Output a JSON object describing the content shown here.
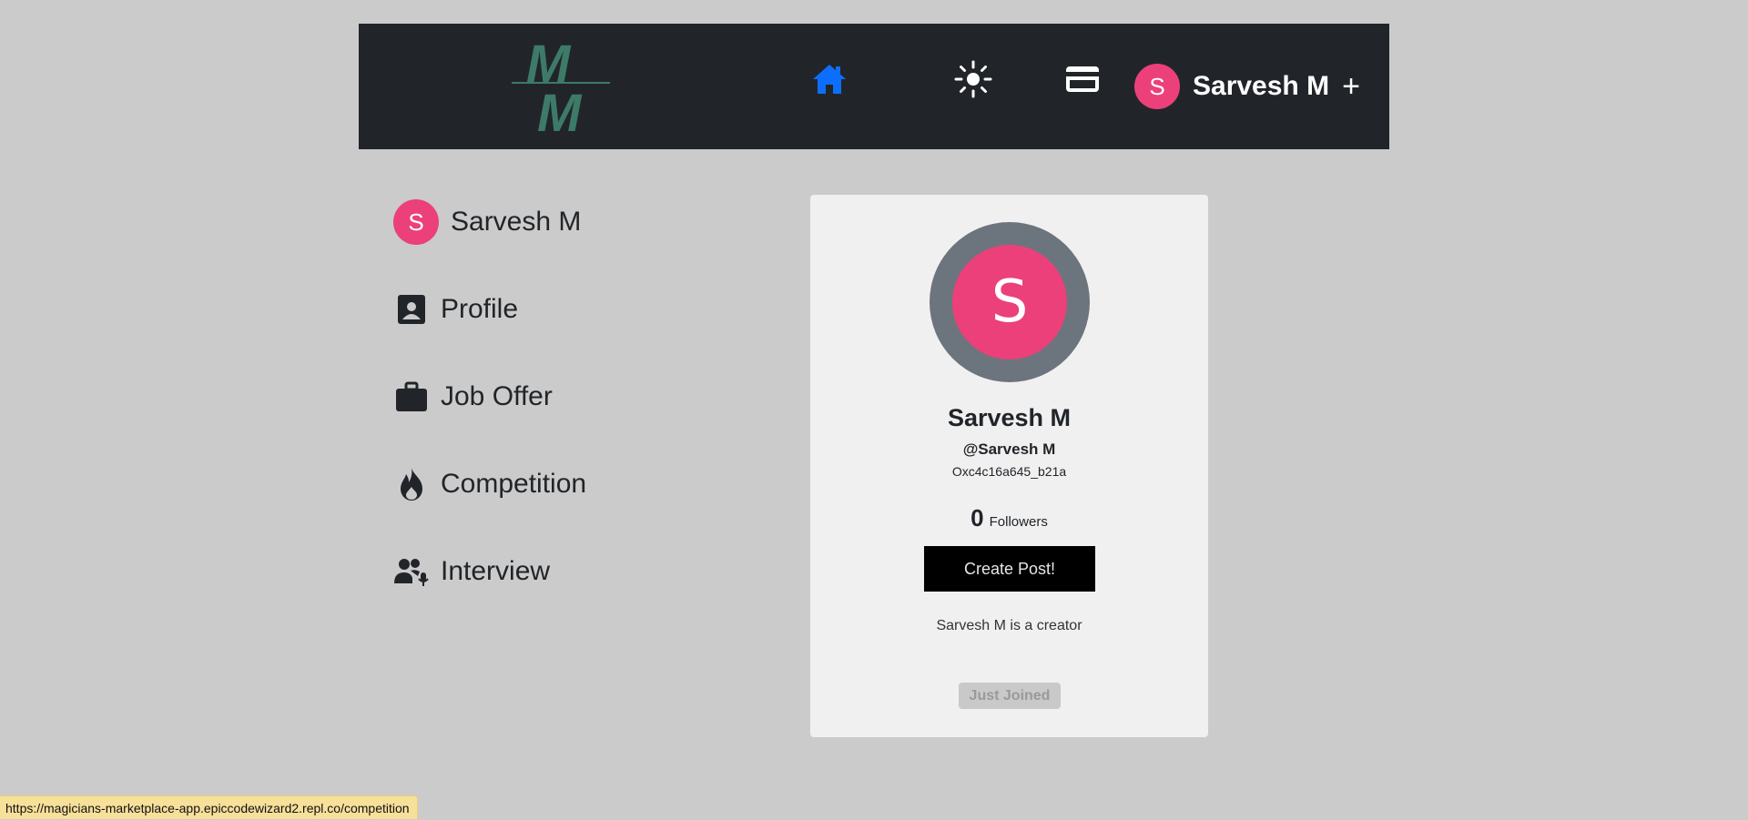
{
  "navbar": {
    "logo_letters": "MM",
    "user": {
      "avatar_initial": "S",
      "name": "Sarvesh M",
      "add_symbol": "+"
    },
    "icons": {
      "home": "home-icon",
      "theme": "sun-icon",
      "wallet": "credit-card-icon"
    },
    "colors": {
      "background": "#212529",
      "home_active": "#0d6efd",
      "logo": "#3d7a68"
    }
  },
  "sidebar": {
    "user": {
      "avatar_initial": "S",
      "name": "Sarvesh M"
    },
    "items": [
      {
        "label": "Profile",
        "icon": "profile-card-icon"
      },
      {
        "label": "Job Offer",
        "icon": "briefcase-icon"
      },
      {
        "label": "Competition",
        "icon": "fire-icon"
      },
      {
        "label": "Interview",
        "icon": "people-mic-icon"
      }
    ]
  },
  "profile_card": {
    "avatar_initial": "S",
    "name": "Sarvesh M",
    "handle": "@Sarvesh M",
    "wallet": "Oxc4c16a645_b21a",
    "followers_count": "0",
    "followers_label": "Followers",
    "create_button": "Create Post!",
    "bio": "Sarvesh M is a creator",
    "badge": "Just Joined",
    "colors": {
      "avatar": "#ec407a",
      "ring": "#6c757d"
    }
  },
  "statusbar": {
    "url": "https://magicians-marketplace-app.epiccodewizard2.repl.co/competition"
  }
}
